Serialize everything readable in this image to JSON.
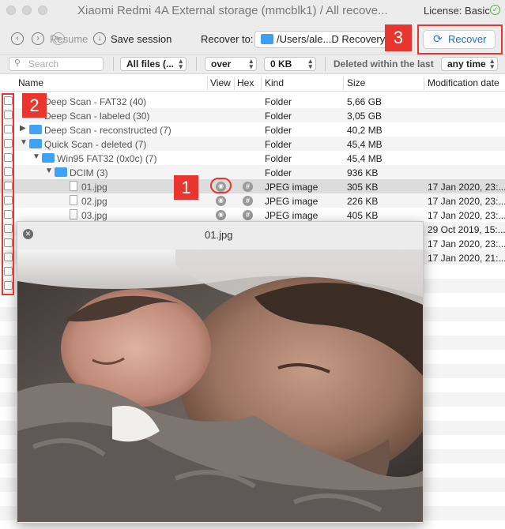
{
  "window": {
    "title": "Xiaomi Redmi 4A External storage (mmcblk1) / All recove...",
    "license_label": "License: Basic"
  },
  "toolbar": {
    "resume_label": "Resume",
    "save_session_label": "Save session",
    "recover_to_label": "Recover to:",
    "recover_path": "/Users/ale...D Recovery",
    "recover_button": "Recover"
  },
  "filters": {
    "search_placeholder": "Search",
    "files_select": "All files (...",
    "size_op_select": "over",
    "size_select": "0 KB",
    "deleted_label": "Deleted within the last",
    "time_select": "any time"
  },
  "columns": {
    "name": "Name",
    "view": "View",
    "hex": "Hex",
    "kind": "Kind",
    "size": "Size",
    "modified": "Modification date"
  },
  "rows": [
    {
      "name": "Deep Scan - FAT32 (40)",
      "kind": "Folder",
      "size": "5,66 GB",
      "date": ""
    },
    {
      "name": "Deep Scan - labeled (30)",
      "kind": "Folder",
      "size": "3,05 GB",
      "date": ""
    },
    {
      "name": "Deep Scan - reconstructed (7)",
      "kind": "Folder",
      "size": "40,2 MB",
      "date": ""
    },
    {
      "name": "Quick Scan - deleted (7)",
      "kind": "Folder",
      "size": "45,4 MB",
      "date": ""
    },
    {
      "name": "Win95 FAT32 (0x0c) (7)",
      "kind": "Folder",
      "size": "45,4 MB",
      "date": ""
    },
    {
      "name": "DCIM (3)",
      "kind": "Folder",
      "size": "936 KB",
      "date": ""
    },
    {
      "name": "01.jpg",
      "kind": "JPEG image",
      "size": "305 KB",
      "date": "17 Jan 2020, 23:..."
    },
    {
      "name": "02.jpg",
      "kind": "JPEG image",
      "size": "226 KB",
      "date": "17 Jan 2020, 23:..."
    },
    {
      "name": "03.jpg",
      "kind": "JPEG image",
      "size": "405 KB",
      "date": "17 Jan 2020, 23:..."
    },
    {
      "name": "",
      "kind": "",
      "size": "",
      "date": "29 Oct 2019, 15:..."
    },
    {
      "name": "",
      "kind": "",
      "size": "",
      "date": "17 Jan 2020, 23:..."
    },
    {
      "name": "",
      "kind": "",
      "size": "",
      "date": "17 Jan 2020, 21:..."
    }
  ],
  "preview": {
    "title": "01.jpg"
  },
  "annotations": {
    "one": "1",
    "two": "2",
    "three": "3"
  },
  "icons": [
    "back-icon",
    "forward-icon",
    "resume-icon",
    "save-session-icon",
    "folder-icon",
    "recover-icon",
    "search-icon",
    "eye-icon",
    "hex-icon",
    "close-icon",
    "check-icon"
  ],
  "colors": {
    "accent": "#1f6fd1",
    "folder": "#3fa2f2",
    "annotation_red": "#e8352e",
    "license_ok": "#5ba84c"
  }
}
